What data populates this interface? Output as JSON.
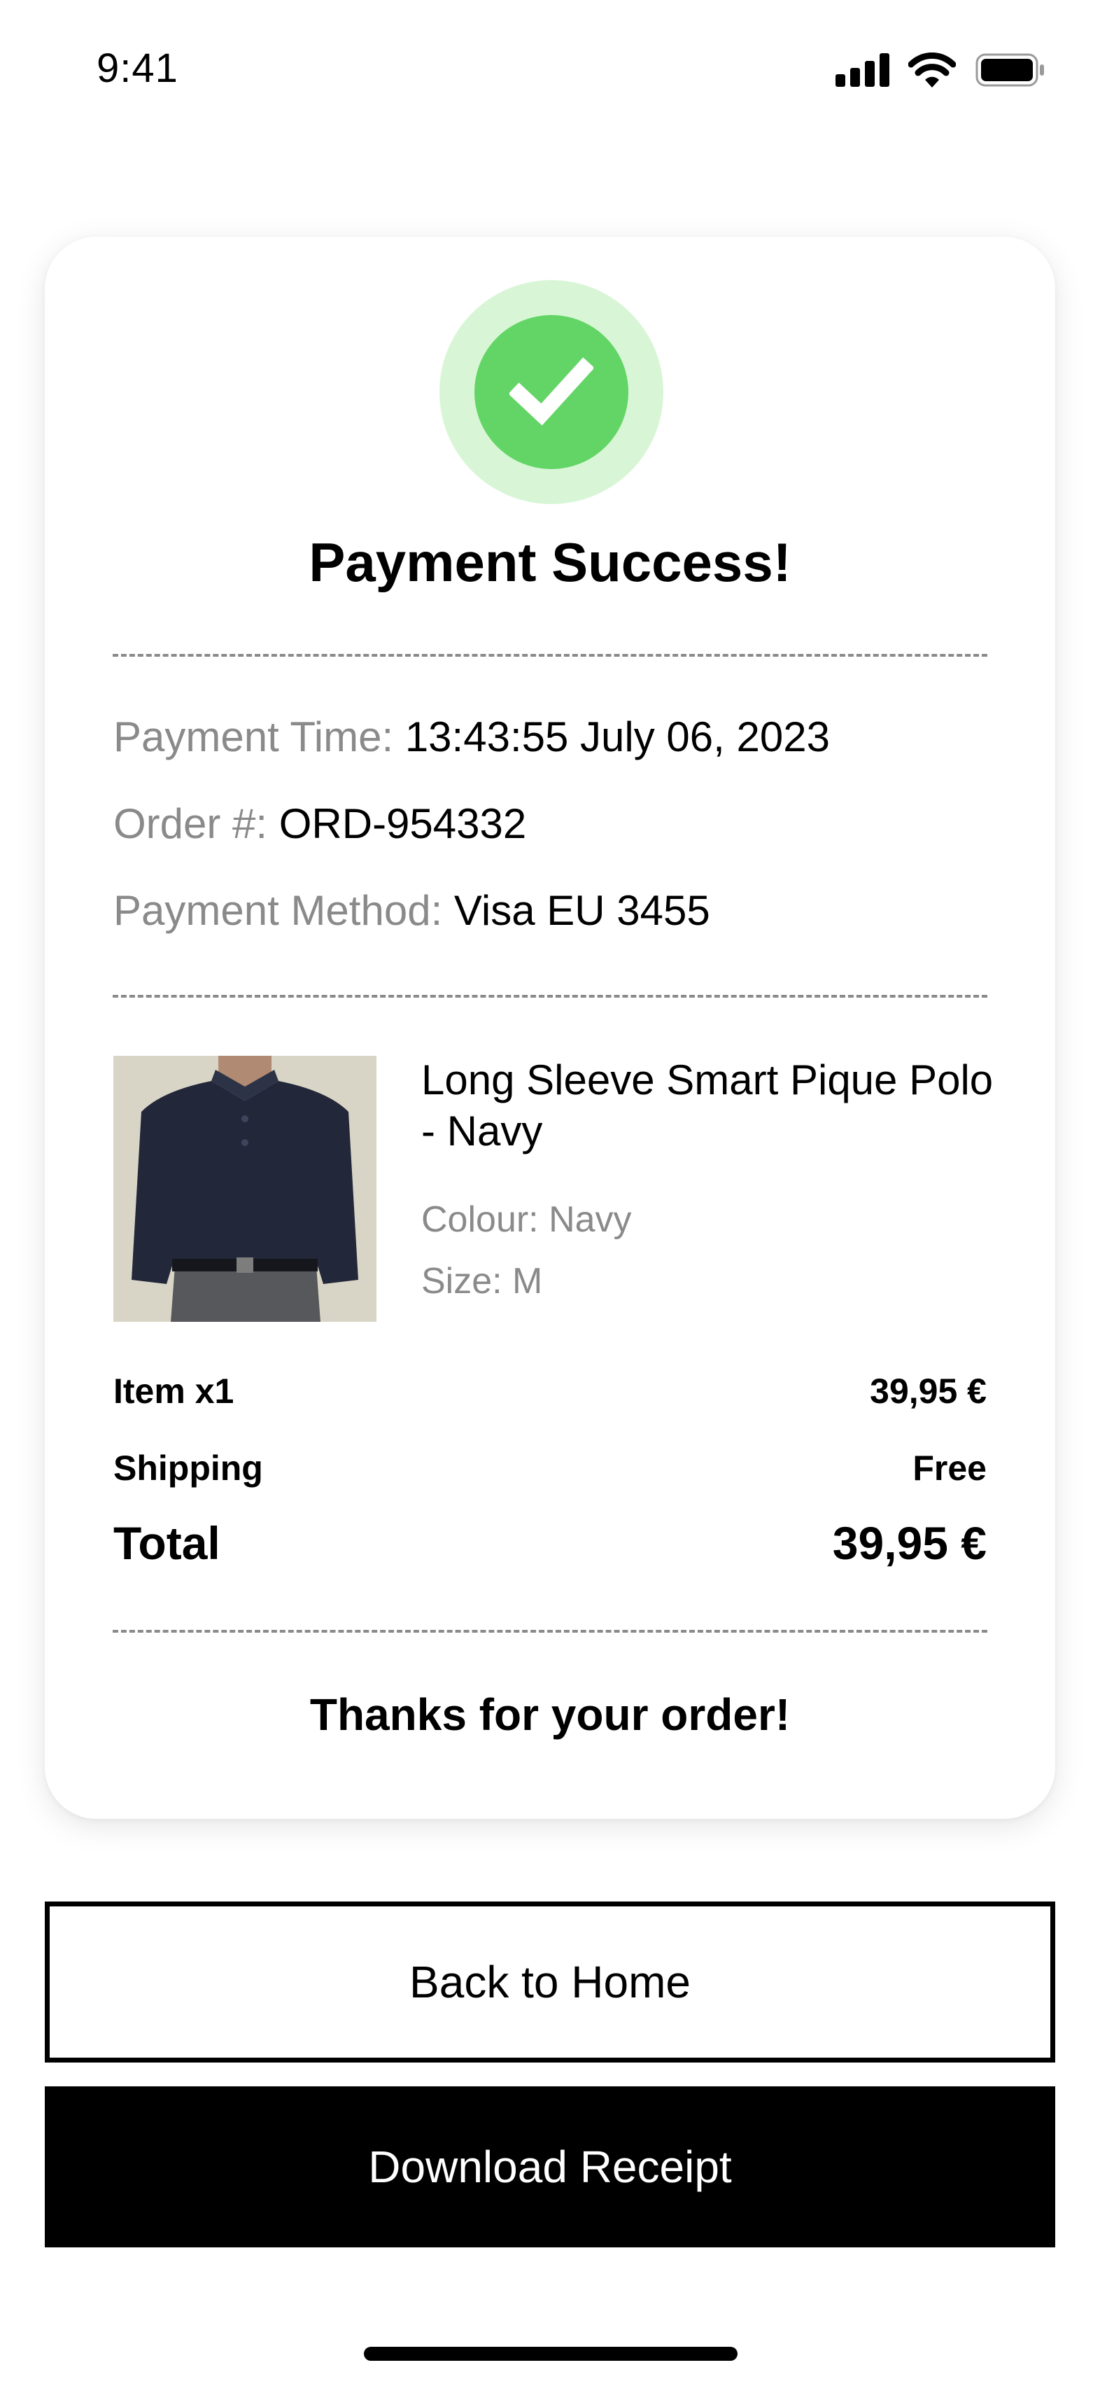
{
  "status_bar": {
    "time": "9:41",
    "signal_icon": "cellular-signal-icon",
    "wifi_icon": "wifi-icon",
    "battery_icon": "battery-icon"
  },
  "receipt": {
    "success_icon": "checkmark-icon",
    "success_color": "#63d566",
    "title": "Payment Success!",
    "payment_time_label": "Payment Time:",
    "payment_time_value": "13:43:55 July 06, 2023",
    "order_label": "Order #:",
    "order_value": "ORD-954332",
    "method_label": "Payment Method:",
    "method_value": "Visa EU 3455",
    "product": {
      "image": "navy-polo-shirt-photo",
      "name": "Long Sleeve Smart Pique Polo - Navy",
      "colour": "Colour: Navy",
      "size": "Size: M"
    },
    "summary": {
      "item_label": "Item x1",
      "item_value": "39,95 €",
      "shipping_label": "Shipping",
      "shipping_value": "Free",
      "total_label": "Total",
      "total_value": "39,95 €"
    },
    "thanks": "Thanks for your order!"
  },
  "actions": {
    "back_home": "Back to Home",
    "download_receipt": "Download Receipt"
  }
}
